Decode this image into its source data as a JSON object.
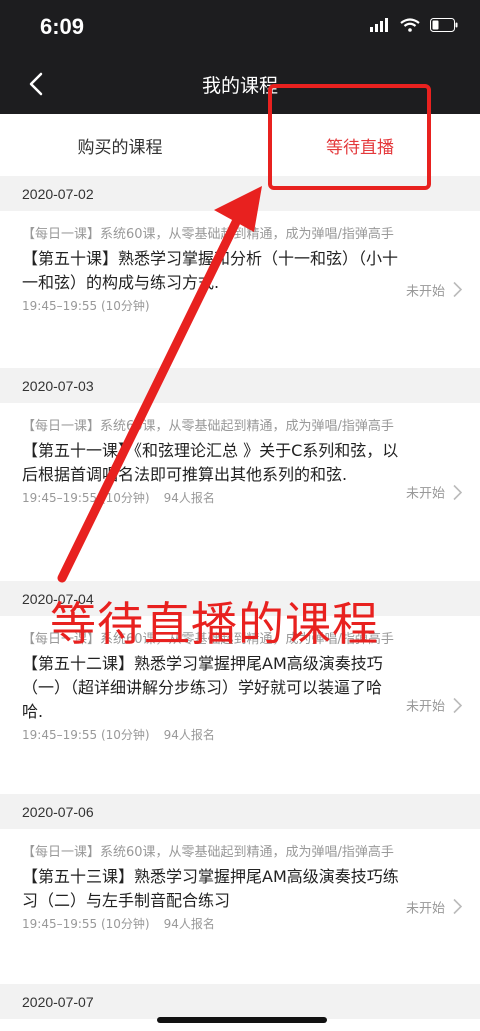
{
  "status_bar": {
    "time": "6:09"
  },
  "navbar": {
    "title": "我的课程"
  },
  "tabs": [
    {
      "label": "购买的课程",
      "active": false
    },
    {
      "label": "等待直播",
      "active": true
    }
  ],
  "courses": [
    {
      "date": "2020-07-02",
      "series": "【每日一课】系统60课，从零基础起到精通，成为弹唱/指弹高手",
      "title": "【第五十课】熟悉学习掌握和分析（十一和弦）（小十一和弦）的构成与练习方式.",
      "time": "19:45–19:55 (10分钟)",
      "signups": "",
      "status": "未开始"
    },
    {
      "date": "2020-07-03",
      "series": "【每日一课】系统60课，从零基础起到精通，成为弹唱/指弹高手",
      "title": "【第五十一课】《和弦理论汇总 》关于C系列和弦，以后根据首调唱名法即可推算出其他系列的和弦.",
      "time": "19:45–19:55 (10分钟)",
      "signups": "94人报名",
      "status": "未开始"
    },
    {
      "date": "2020-07-04",
      "series": "【每日一课】系统60课，从零基础起到精通，成为弹唱/指弹高手",
      "title": "【第五十二课】熟悉学习掌握押尾AM高级演奏技巧（一）（超详细讲解分步练习）学好就可以装逼了哈哈.",
      "time": "19:45–19:55 (10分钟)",
      "signups": "94人报名",
      "status": "未开始"
    },
    {
      "date": "2020-07-06",
      "series": "【每日一课】系统60课，从零基础起到精通，成为弹唱/指弹高手",
      "title": "【第五十三课】熟悉学习掌握押尾AM高级演奏技巧练习（二）与左手制音配合练习",
      "time": "19:45–19:55 (10分钟)",
      "signups": "94人报名",
      "status": "未开始"
    }
  ],
  "last_date": "2020-07-07",
  "annotation": {
    "text": "等待直播的课程",
    "color": "#e8211f"
  },
  "colors": {
    "accent": "#e4393c",
    "bar": "#1d1d1f"
  },
  "icons": [
    "signal-icon",
    "wifi-icon",
    "battery-icon",
    "back-arrow-icon",
    "chevron-right-icon"
  ]
}
